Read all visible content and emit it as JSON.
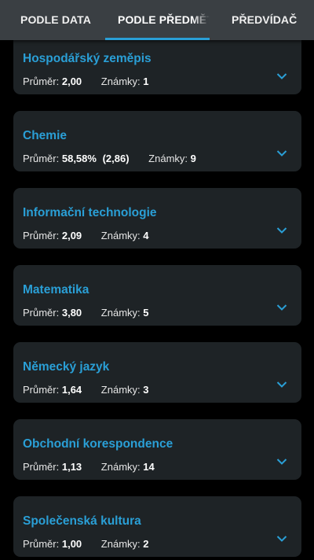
{
  "tabs": [
    {
      "label": "PODLE DATA"
    },
    {
      "label": "PODLE PŘEDMĚTŮ"
    },
    {
      "label": "PŘEDVÍDAČ"
    }
  ],
  "stats_labels": {
    "average": "Průměr:",
    "grades": "Známky:"
  },
  "subjects": [
    {
      "name": "Hospodářský zeměpis",
      "average": "2,00",
      "weighted": "",
      "grades": "1"
    },
    {
      "name": "Chemie",
      "average": "58,58%",
      "weighted": "(2,86)",
      "grades": "9"
    },
    {
      "name": "Informační technologie",
      "average": "2,09",
      "weighted": "",
      "grades": "4"
    },
    {
      "name": "Matematika",
      "average": "3,80",
      "weighted": "",
      "grades": "5"
    },
    {
      "name": "Německý jazyk",
      "average": "1,64",
      "weighted": "",
      "grades": "3"
    },
    {
      "name": "Obchodní korespondence",
      "average": "1,13",
      "weighted": "",
      "grades": "14"
    },
    {
      "name": "Společenská kultura",
      "average": "1,00",
      "weighted": "",
      "grades": "2"
    }
  ],
  "colors": {
    "accent": "#2a9fd6",
    "card": "#1e2326",
    "tabbar": "#3a3f43",
    "background": "#000000"
  },
  "icons": {
    "expand": "chevron-down-icon"
  }
}
